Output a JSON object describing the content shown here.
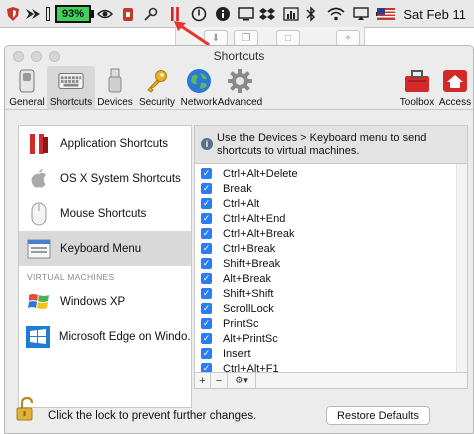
{
  "menubar": {
    "battery_text": "93%",
    "clock": "Sat Feb 11",
    "icons": [
      "shield-icon",
      "chevron-icon",
      "battery-icon",
      "eye-icon",
      "lock-app-icon",
      "key-icon",
      "parallels-icon",
      "power-icon",
      "info-icon",
      "screen-icon",
      "dropbox-icon",
      "chart-icon",
      "bluetooth-icon",
      "wifi-icon",
      "airplay-icon",
      "volume-icon",
      "flag-icon"
    ]
  },
  "window": {
    "title": "Shortcuts"
  },
  "toolbar": {
    "items": [
      {
        "label": "General",
        "icon": "switch-icon"
      },
      {
        "label": "Shortcuts",
        "icon": "keyboard-icon"
      },
      {
        "label": "Devices",
        "icon": "usb-icon"
      },
      {
        "label": "Security",
        "icon": "key-icon"
      },
      {
        "label": "Network",
        "icon": "globe-icon"
      },
      {
        "label": "Advanced",
        "icon": "gear-icon"
      },
      {
        "label": "Toolbox",
        "icon": "toolbox-icon"
      },
      {
        "label": "Access",
        "icon": "house-icon"
      }
    ]
  },
  "sidebar": {
    "items": [
      {
        "label": "Application Shortcuts",
        "icon": "parallels-icon"
      },
      {
        "label": "OS X System Shortcuts",
        "icon": "apple-icon"
      },
      {
        "label": "Mouse Shortcuts",
        "icon": "mouse-icon"
      },
      {
        "label": "Keyboard Menu",
        "icon": "keyboard-menu-icon"
      }
    ],
    "section_header": "VIRTUAL MACHINES",
    "vms": [
      {
        "label": "Windows XP",
        "icon": "windows-xp-icon"
      },
      {
        "label": "Microsoft Edge on Windo...",
        "icon": "windows-10-icon"
      }
    ]
  },
  "panel": {
    "info_text": "Use the Devices > Keyboard menu to send shortcuts to virtual machines.",
    "shortcuts": [
      "Ctrl+Alt+Delete",
      "Break",
      "Ctrl+Alt",
      "Ctrl+Alt+End",
      "Ctrl+Alt+Break",
      "Ctrl+Break",
      "Shift+Break",
      "Alt+Break",
      "Shift+Shift",
      "ScrollLock",
      "PrintSc",
      "Alt+PrintSc",
      "Insert",
      "Ctrl+Alt+F1"
    ],
    "add_label": "+",
    "remove_label": "−",
    "action_label": "⚙▾"
  },
  "footer": {
    "lock_text": "Click the lock to prevent further changes.",
    "restore_label": "Restore Defaults"
  },
  "colors": {
    "checkbox": "#2a7cf2",
    "battery": "#3fd15c",
    "selection": "#d9d9d9",
    "arrow": "#e8352b"
  }
}
